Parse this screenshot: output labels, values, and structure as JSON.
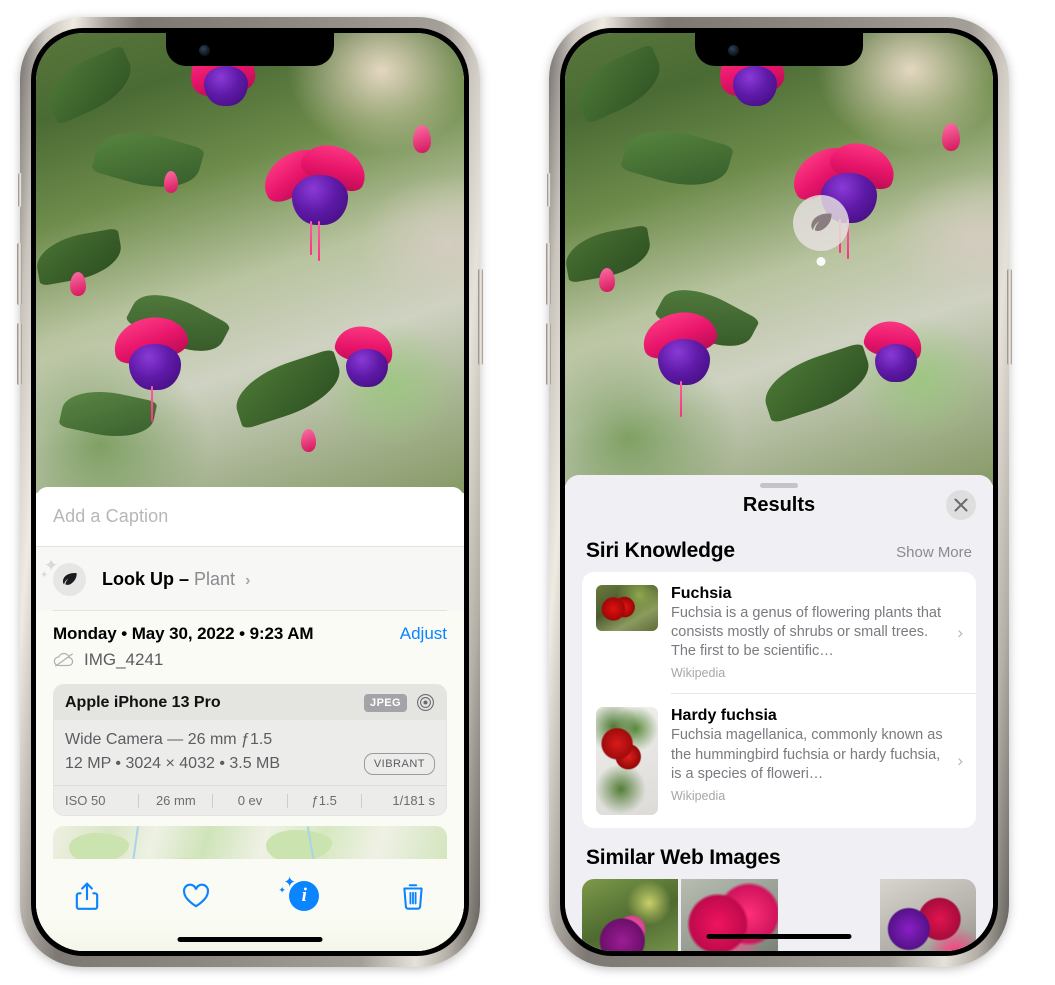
{
  "left_phone": {
    "caption": {
      "placeholder": "Add a Caption",
      "value": ""
    },
    "lookup": {
      "label": "Look Up –",
      "subject": "Plant",
      "chevron": "›",
      "icon": "leaf-icon",
      "sparkle": "✦",
      "sparkle_small": "✦"
    },
    "meta": {
      "date": "Monday • May 30, 2022 • 9:23 AM",
      "adjust": "Adjust",
      "filename": "IMG_4241",
      "cloud_icon": "cloud-slash-icon"
    },
    "camera": {
      "model": "Apple iPhone 13 Pro",
      "format_badge": "JPEG",
      "lens_icon": "aperture-icon",
      "lens_line": "Wide Camera — 26 mm ƒ1.5",
      "specs_line": "12 MP • 3024 × 4032 • 3.5 MB",
      "style_badge": "VIBRANT",
      "exif": [
        "ISO 50",
        "26 mm",
        "0 ev",
        "ƒ1.5",
        "1/181 s"
      ]
    },
    "toolbar": {
      "share": "share-icon",
      "favorite": "heart-icon",
      "info": "info-sparkle-icon",
      "info_letter": "i",
      "delete": "trash-icon"
    },
    "colors": {
      "accent": "#0a84ff",
      "sheet_bg": "#fbfbf5",
      "card_bg": "#ececea"
    }
  },
  "right_phone": {
    "visual_lookup_badge": {
      "icon": "leaf-icon"
    },
    "sheet": {
      "title": "Results",
      "close": "✕",
      "sections": [
        {
          "title": "Siri Knowledge",
          "action": "Show More",
          "items": [
            {
              "title": "Fuchsia",
              "description": "Fuchsia is a genus of flowering plants that consists mostly of shrubs or small trees. The first to be scientific…",
              "source": "Wikipedia",
              "chevron": "›"
            },
            {
              "title": "Hardy fuchsia",
              "description": "Fuchsia magellanica, commonly known as the hummingbird fuchsia or hardy fuchsia, is a species of floweri…",
              "source": "Wikipedia",
              "chevron": "›"
            }
          ]
        },
        {
          "title": "Similar Web Images",
          "images": [
            "web-image-1",
            "web-image-2",
            "web-image-3",
            "web-image-4"
          ]
        }
      ]
    },
    "colors": {
      "sheet_bg": "#f0f0f4",
      "card_bg": "#ffffff"
    }
  }
}
